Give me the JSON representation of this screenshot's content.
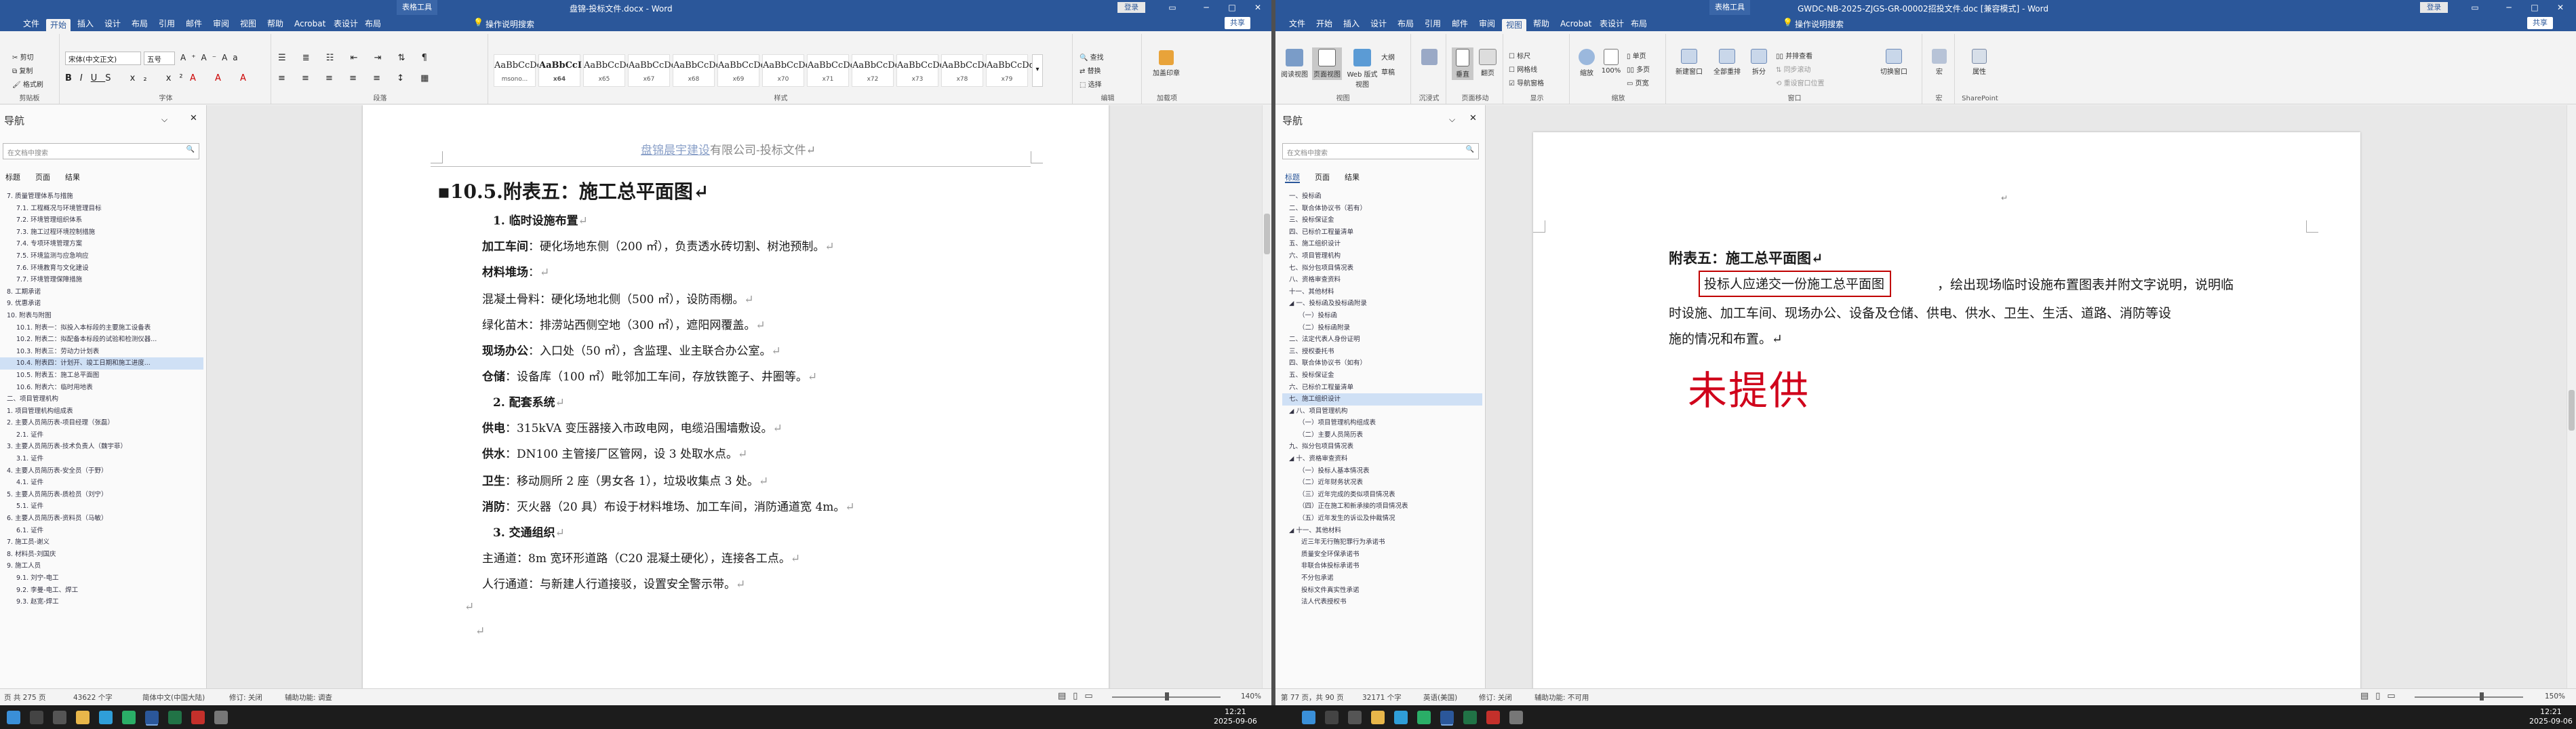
{
  "left": {
    "title": "盘锦-投标文件.docx - Word",
    "context_tab": "表格工具",
    "menu_tabs": [
      "文件",
      "开始",
      "插入",
      "设计",
      "布局",
      "引用",
      "邮件",
      "审阅",
      "视图",
      "帮助",
      "Acrobat",
      "表设计",
      "布局"
    ],
    "search_hint": "操作说明搜索",
    "share": "共享",
    "login": "登录",
    "ribbon": {
      "clipboard": {
        "cut": "剪切",
        "copy": "复制",
        "paint": "格式刷",
        "label": "剪贴板"
      },
      "font": {
        "name": "宋体(中文正文)",
        "size": "五号",
        "label": "字体"
      },
      "paragraph": {
        "label": "段落"
      },
      "styles": {
        "items": [
          {
            "sample": "AaBbCcDc",
            "name": "msono..."
          },
          {
            "sample": "AaBbCcI",
            "name": "x64"
          },
          {
            "sample": "AaBbCcDc",
            "name": "x65"
          },
          {
            "sample": "AaBbCcDd",
            "name": "x67"
          },
          {
            "sample": "AaBbCcDd",
            "name": "x68"
          },
          {
            "sample": "AaBbCcDd",
            "name": "x69"
          },
          {
            "sample": "AaBbCcDd",
            "name": "x70"
          },
          {
            "sample": "AaBbCcDd",
            "name": "x71"
          },
          {
            "sample": "AaBbCcDd",
            "name": "x72"
          },
          {
            "sample": "AaBbCcDd",
            "name": "x73"
          },
          {
            "sample": "AaBbCcDd",
            "name": "x78"
          },
          {
            "sample": "AaBbCcDd",
            "name": "x79"
          }
        ],
        "label": "样式"
      },
      "editing": {
        "find": "查找",
        "replace": "替换",
        "select": "选择",
        "label": "编辑"
      },
      "addon": {
        "sign": "加盖印章",
        "label": "加载项"
      }
    },
    "nav": {
      "title": "导航",
      "search_placeholder": "在文档中搜索",
      "tabs": [
        "标题",
        "页面",
        "结果"
      ],
      "items": [
        "7. 质量管理体系与措施",
        "7.1. 工程概况与环境管理目标",
        "7.2. 环境管理组织体系",
        "7.3. 施工过程环境控制措施",
        "7.4. 专项环境管理方案",
        "7.5. 环境监测与应急响应",
        "7.6. 环境教育与文化建设",
        "7.7. 环境管理保障措施",
        "8. 工期承诺",
        "9. 优惠承诺",
        "10. 附表与附图",
        "10.1. 附表一：拟投入本标段的主要施工设备表",
        "10.2. 附表二：拟配备本标段的试验和检测仪器...",
        "10.3. 附表三：劳动力计划表",
        "10.4. 附表四：计划开、竣工日期和施工进度...",
        "10.5. 附表五：施工总平面图",
        "10.6. 附表六：临时用地表",
        "二、项目管理机构",
        "1. 项目管理机构组成表",
        "2. 主要人员简历表-项目经理（张磊）",
        "2.1. 证件",
        "3. 主要人员简历表-技术负责人（魏宇菲）",
        "3.1. 证件",
        "4. 主要人员简历表-安全员（于野）",
        "4.1. 证件",
        "5. 主要人员简历表-质检员（刘宁）",
        "5.1. 证件",
        "6. 主要人员简历表-资料员（马敏）",
        "6.1. 证件",
        "7. 施工员-谢义",
        "8. 材料员-刘国庆",
        "9. 施工人员",
        "9.1. 刘宁-电工",
        "9.2. 李曼-电工、焊工",
        "9.3. 赵宽-焊工"
      ],
      "selected": 14
    },
    "doc": {
      "header": "盘锦晨宇建设有限公司-投标文件",
      "header_link": "盘锦晨宇建设",
      "header_rest": "有限公司-投标文件",
      "heading": "10.5.附表五：施工总平面图",
      "lines": [
        {
          "b": "1. 临时设施布置",
          "t": ""
        },
        {
          "b": "加工车间",
          "t": "：硬化场地东侧（200 ㎡），负责透水砖切割、树池预制。"
        },
        {
          "b": "材料堆场",
          "t": "："
        },
        {
          "b": "",
          "t": "混凝土骨料：硬化场地北侧（500 ㎡），设防雨棚。"
        },
        {
          "b": "",
          "t": "绿化苗木：排涝站西侧空地（300 ㎡），遮阳网覆盖。"
        },
        {
          "b": "现场办公",
          "t": "：入口处（50 ㎡），含监理、业主联合办公室。"
        },
        {
          "b": "仓储",
          "t": "：设备库（100 ㎡）毗邻加工车间，存放铁篦子、井圈等。"
        },
        {
          "b": "2. 配套系统",
          "t": ""
        },
        {
          "b": "供电",
          "t": "：315kVA 变压器接入市政电网，电缆沿围墙敷设。"
        },
        {
          "b": "供水",
          "t": "：DN100 主管接厂区管网，设 3 处取水点。"
        },
        {
          "b": "卫生",
          "t": "：移动厕所 2 座（男女各 1），垃圾收集点 3 处。"
        },
        {
          "b": "消防",
          "t": "：灭火器（20 具）布设于材料堆场、加工车间，消防通道宽 4m。"
        },
        {
          "b": "3. 交通组织",
          "t": ""
        },
        {
          "b": "",
          "t": "主通道：8m 宽环形道路（C20 混凝土硬化），连接各工点。"
        },
        {
          "b": "",
          "t": "人行通道：与新建人行道接驳，设置安全警示带。"
        }
      ]
    },
    "status": {
      "page": "页 共 275 页",
      "words": "43622 个字",
      "lang": "简体中文(中国大陆)",
      "track": "修订: 关闭",
      "access": "辅助功能: 调查",
      "zoom": "140%"
    },
    "clock": {
      "time": "12:21",
      "date": "2025-09-06"
    }
  },
  "right": {
    "title": "GWDC-NB-2025-ZJGS-GR-00002招投文件.doc [兼容模式] - Word",
    "context_tab": "表格工具",
    "menu_tabs": [
      "文件",
      "开始",
      "插入",
      "设计",
      "布局",
      "引用",
      "邮件",
      "审阅",
      "视图",
      "帮助",
      "Acrobat",
      "表设计",
      "布局"
    ],
    "search_hint": "操作说明搜索",
    "share": "共享",
    "login": "登录",
    "ribbon": {
      "views": [
        "阅读视图",
        "页面视图",
        "Web 版式视图"
      ],
      "views_label": "视图",
      "outline": [
        "大纲",
        "草稿"
      ],
      "immersive": "沉浸式",
      "page_move": [
        "垂直",
        "翻页"
      ],
      "page_move_label": "页面移动",
      "show": [
        "标尺",
        "网格线",
        "导航窗格"
      ],
      "show_label": "显示",
      "zoom": [
        "缩放",
        "100%",
        "单页",
        "多页",
        "页宽"
      ],
      "zoom_label": "缩放",
      "window": [
        "新建窗口",
        "全部重排",
        "拆分",
        "并排查看",
        "同步滚动",
        "重设窗口位置",
        "切换窗口"
      ],
      "window_label": "窗口",
      "macro": "宏",
      "macro_label": "宏",
      "sharepoint": "属性",
      "sharepoint_label": "SharePoint"
    },
    "nav": {
      "title": "导航",
      "search_placeholder": "在文档中搜索",
      "tabs": [
        "标题",
        "页面",
        "结果"
      ],
      "items": [
        "一、投标函",
        "二、联合体协议书（若有）",
        "三、投标保证金",
        "四、已标价工程量清单",
        "五、施工组织设计",
        "六、项目管理机构",
        "七、拟分包项目情况表",
        "八、资格审查资料",
        "十一、其他材料",
        "◢ 一、投标函及投标函附录",
        "（一）投标函",
        "（二）投标函附录",
        "二、法定代表人身份证明",
        "三、授权委托书",
        "四、联合体协议书（如有）",
        "五、投标保证金",
        "六、已标价工程量清单",
        "七、施工组织设计",
        "◢ 八、项目管理机构",
        "（一）项目管理机构组成表",
        "（二）主要人员简历表",
        "九、拟分包项目情况表",
        "◢ 十、资格审查资料",
        "（一）投标人基本情况表",
        "（二）近年财务状况表",
        "（三）近年完成的类似项目情况表",
        "（四）正在施工和新承接的项目情况表",
        "（五）近年发生的诉讼及仲裁情况",
        "◢ 十一、其他材料",
        "近三年无行贿犯罪行为承诺书",
        "质量安全环保承诺书",
        "非联合体投标承诺书",
        "不分包承诺",
        "投标文件真实性承诺",
        "法人代表授权书"
      ],
      "selected": 17
    },
    "doc": {
      "heading": "附表五：施工总平面图",
      "boxed": "投标人应递交一份施工总平面图",
      "para1_rest": "，绘出现场临时设施布置图表并附文字说明，说明临",
      "para2": "时设施、加工车间、现场办公、设备及仓储、供电、供水、卫生、生活、道路、消防等设",
      "para3": "施的情况和布置。",
      "stamp": "未提供"
    },
    "status": {
      "page": "第 77 页，共 90 页",
      "words": "32171 个字",
      "lang": "英语(美国)",
      "track": "修订: 关闭",
      "access": "辅助功能: 不可用",
      "zoom": "150%"
    },
    "clock": {
      "time": "12:21",
      "date": "2025-09-06"
    }
  },
  "colors": {
    "word_blue": "#2b579a",
    "stamp_red": "#d0021b",
    "box_red": "#c00000",
    "taskbar": "#1c1c1c"
  },
  "taskbar_icons": [
    "start-icon",
    "search-icon",
    "taskview-icon",
    "explorer-icon",
    "edge-icon",
    "wechat-icon",
    "word-icon",
    "excel-icon",
    "pdf-icon",
    "settings-icon"
  ]
}
